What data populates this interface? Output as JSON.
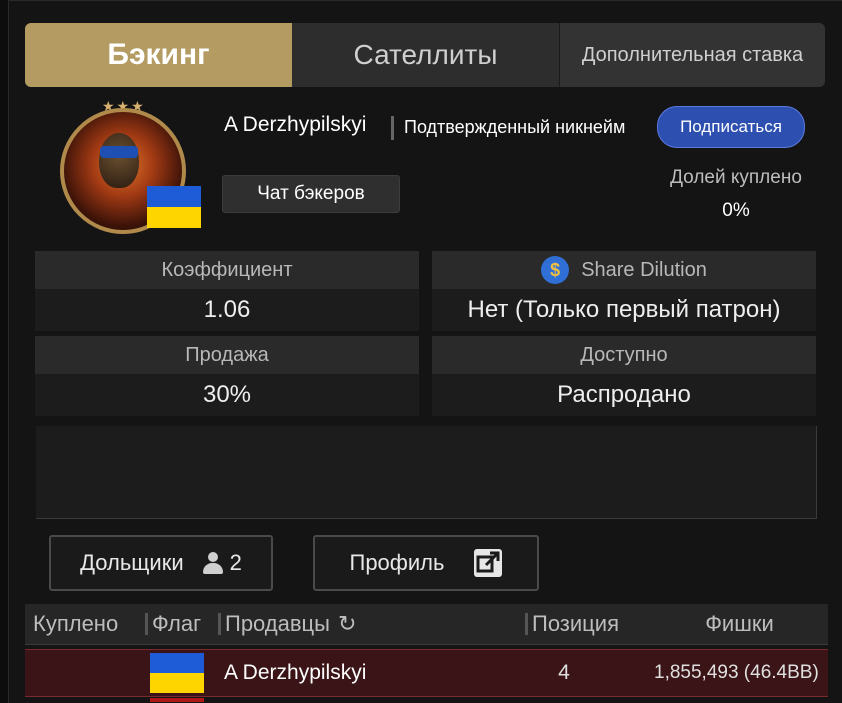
{
  "tabs": {
    "backing": "Бэкинг",
    "satellites": "Сателлиты",
    "extra_bet": "Дополнительная ставка"
  },
  "player": {
    "name": "A Derzhypilskyi",
    "verified_label": "Подтвержденный никнейм",
    "subscribe_label": "Подписаться",
    "chat_label": "Чат бэкеров",
    "shares_bought_label": "Долей куплено",
    "shares_bought_value": "0%",
    "flag": "ukraine",
    "avatar_stars": "★★★"
  },
  "stats": {
    "coefficient_label": "Коэффициент",
    "coefficient_value": "1.06",
    "dilution_label": "Share Dilution",
    "dilution_value": "Нет (Только первый патрон)",
    "sale_label": "Продажа",
    "sale_value": "30%",
    "available_label": "Доступно",
    "available_value": "Распродано"
  },
  "buttons": {
    "shareholders_label": "Дольщики",
    "shareholders_count": "2",
    "profile_label": "Профиль"
  },
  "table": {
    "headers": {
      "bought": "Куплено",
      "flag": "Флаг",
      "sellers": "Продавцы",
      "position": "Позиция",
      "chips": "Фишки"
    },
    "rows": [
      {
        "bought": "",
        "flag": "ukraine",
        "seller": "A Derzhypilskyi",
        "position": "4",
        "chips": "1,855,493 (46.4BB)"
      }
    ]
  },
  "colors": {
    "accent_gold": "#b39b62",
    "subscribe_blue": "#2d4fb0",
    "row_highlight": "#3a1416",
    "flag_blue": "#1e5bd6",
    "flag_yellow": "#ffd500"
  }
}
